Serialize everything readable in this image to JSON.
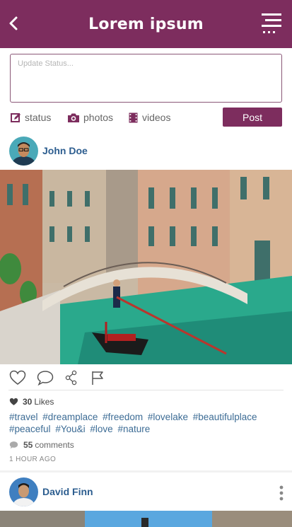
{
  "header": {
    "title": "Lorem ipsum"
  },
  "composer": {
    "placeholder": "Update Status...",
    "actions": [
      {
        "label": "status",
        "icon": "edit-icon"
      },
      {
        "label": "photos",
        "icon": "camera-icon"
      },
      {
        "label": "videos",
        "icon": "film-icon"
      }
    ],
    "post_label": "Post"
  },
  "posts": [
    {
      "author": "John Doe",
      "likes_count": "30",
      "likes_label": "Likes",
      "hashtags": [
        "#travel",
        "#dreamplace",
        "#freedom",
        "#lovelake",
        "#beautifulplace",
        "#peaceful",
        "#You&i",
        "#love",
        "#nature"
      ],
      "comments_count": "55",
      "comments_label": "comments",
      "time": "1 HOUR AGO"
    },
    {
      "author": "David Finn"
    }
  ],
  "colors": {
    "brand": "#7d2d5e",
    "link": "#2c5d8f",
    "hashtag": "#3d6c95"
  }
}
